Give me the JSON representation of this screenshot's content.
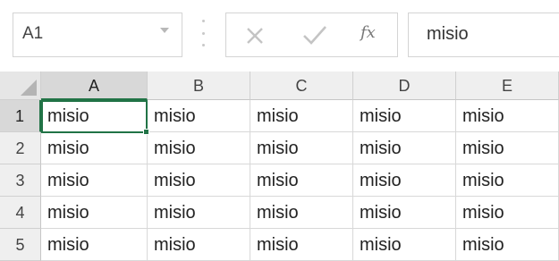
{
  "name_box": {
    "value": "A1"
  },
  "formula_bar": {
    "cancel_icon": "close-icon",
    "enter_icon": "check-icon",
    "fx_label": "fx",
    "value": "misio"
  },
  "grid": {
    "columns": [
      "A",
      "B",
      "C",
      "D",
      "E"
    ],
    "rows": [
      {
        "label": "1",
        "cells": [
          "misio",
          "misio",
          "misio",
          "misio",
          "misio"
        ]
      },
      {
        "label": "2",
        "cells": [
          "misio",
          "misio",
          "misio",
          "misio",
          "misio"
        ]
      },
      {
        "label": "3",
        "cells": [
          "misio",
          "misio",
          "misio",
          "misio",
          "misio"
        ]
      },
      {
        "label": "4",
        "cells": [
          "misio",
          "misio",
          "misio",
          "misio",
          "misio"
        ]
      },
      {
        "label": "5",
        "cells": [
          "misio",
          "misio",
          "misio",
          "misio",
          "misio"
        ]
      }
    ],
    "active_cell": "A1"
  },
  "colors": {
    "selection_accent": "#217346"
  }
}
